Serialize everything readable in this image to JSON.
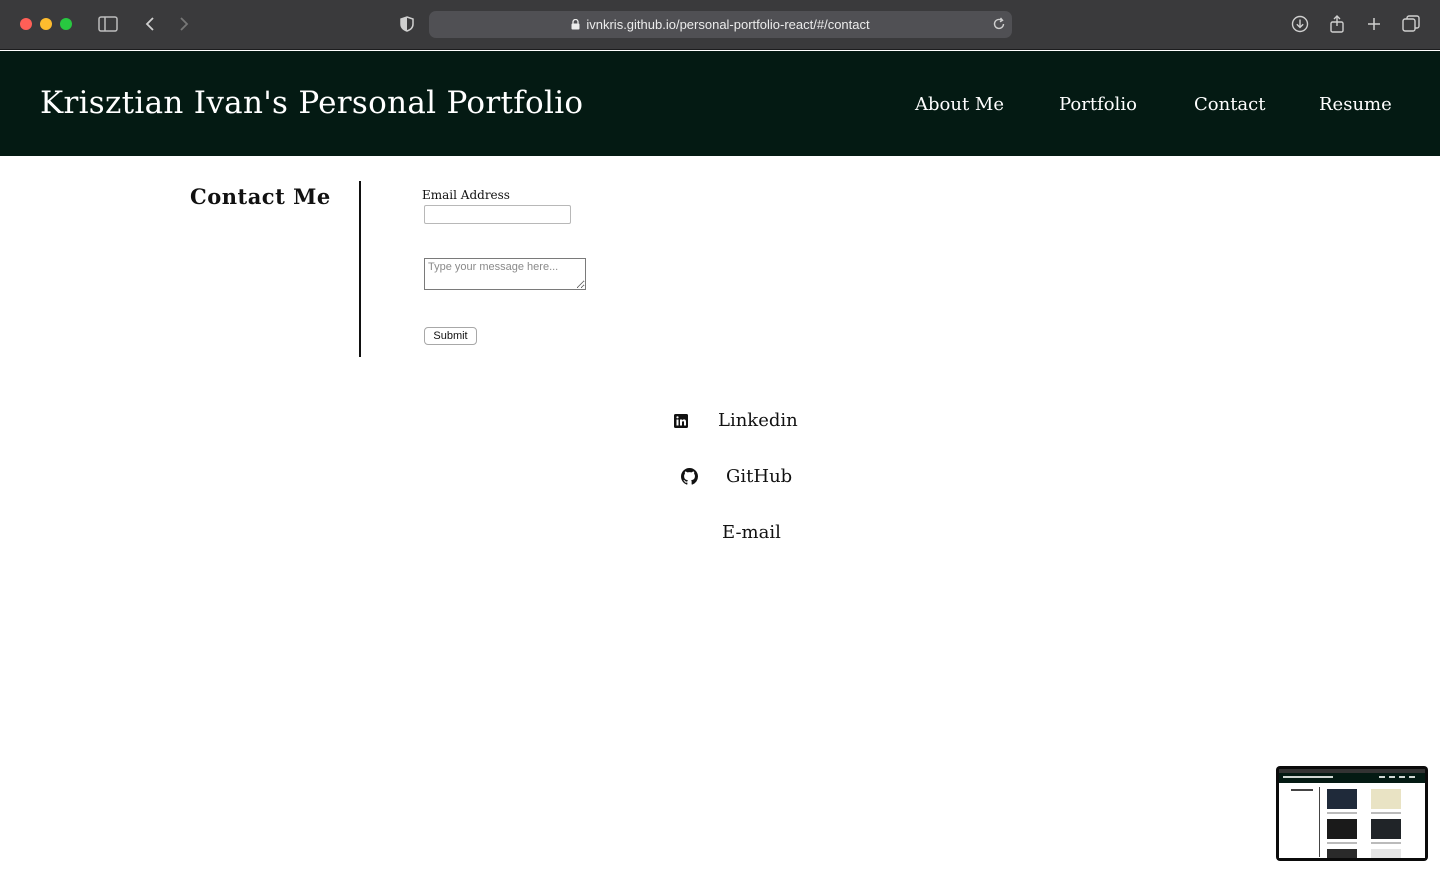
{
  "browser": {
    "url": "ivnkris.github.io/personal-portfolio-react/#/contact"
  },
  "header": {
    "site_title": "Krisztian Ivan's Personal Portfolio",
    "nav": [
      {
        "label": "About Me"
      },
      {
        "label": "Portfolio"
      },
      {
        "label": "Contact"
      },
      {
        "label": "Resume"
      }
    ],
    "background_color": "#041a13"
  },
  "contact": {
    "heading": "Contact Me",
    "email_label": "Email Address",
    "email_value": "",
    "message_placeholder": "Type your message here...",
    "submit_label": "Submit"
  },
  "social": [
    {
      "label": "Linkedin",
      "icon": "linkedin-icon"
    },
    {
      "label": "GitHub",
      "icon": "github-icon"
    },
    {
      "label": "E-mail",
      "icon": ""
    }
  ]
}
